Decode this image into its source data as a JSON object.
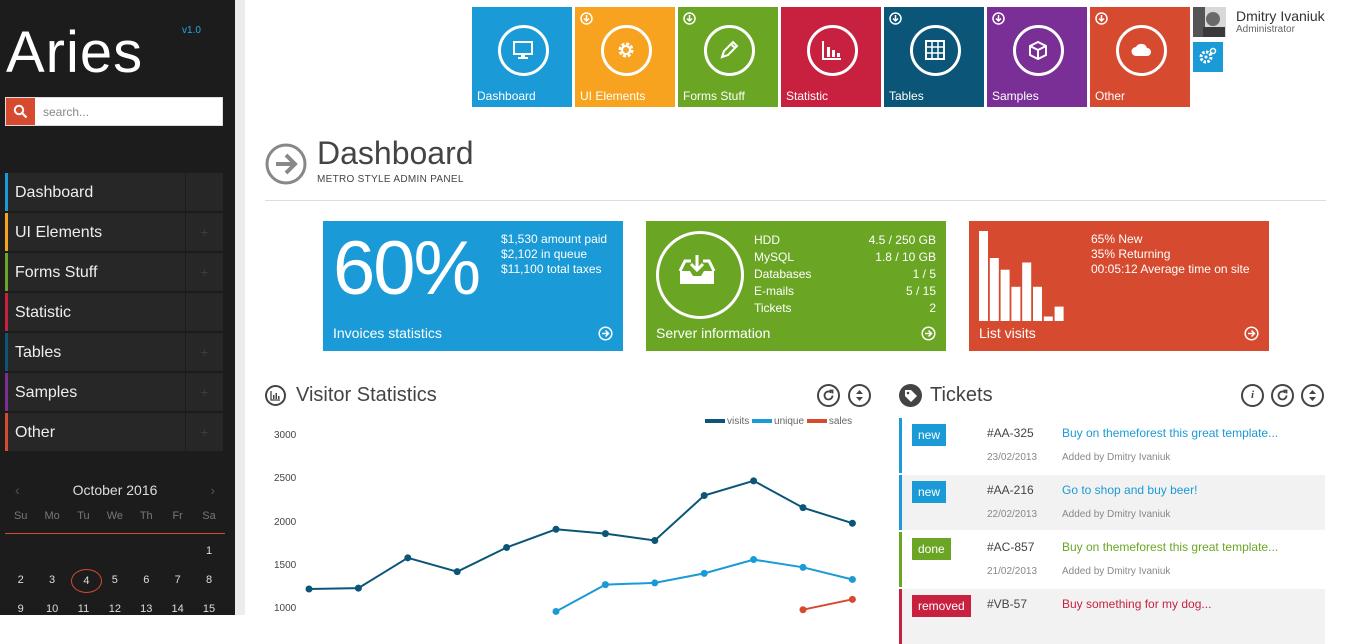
{
  "app": {
    "logo": "Aries",
    "version": "v1.0"
  },
  "search": {
    "placeholder": "search..."
  },
  "sidebar": {
    "items": [
      {
        "label": "Dashboard",
        "color": "#1a9ad6"
      },
      {
        "label": "UI Elements",
        "color": "#f8a31f"
      },
      {
        "label": "Forms Stuff",
        "color": "#6aa624"
      },
      {
        "label": "Statistic",
        "color": "#c8213f"
      },
      {
        "label": "Tables",
        "color": "#0a5578"
      },
      {
        "label": "Samples",
        "color": "#7a2f96"
      },
      {
        "label": "Other",
        "color": "#d64a2f"
      }
    ]
  },
  "calendar": {
    "month": "October 2016",
    "prev": "‹",
    "next": "›",
    "weekdays": [
      "Su",
      "Mo",
      "Tu",
      "We",
      "Th",
      "Fr",
      "Sa"
    ],
    "rows": [
      [
        "",
        "",
        "",
        "",
        "",
        "",
        "1"
      ],
      [
        "2",
        "3",
        "4",
        "5",
        "6",
        "7",
        "8"
      ],
      [
        "9",
        "10",
        "11",
        "12",
        "13",
        "14",
        "15"
      ]
    ],
    "today": "4"
  },
  "tiles": [
    {
      "label": "Dashboard",
      "color": "#1a9ad6",
      "icon": "monitor-icon",
      "arrow": false
    },
    {
      "label": "UI Elements",
      "color": "#f8a31f",
      "icon": "gear-icon",
      "arrow": true
    },
    {
      "label": "Forms Stuff",
      "color": "#6aa624",
      "icon": "pencil-icon",
      "arrow": true
    },
    {
      "label": "Statistic",
      "color": "#c8213f",
      "icon": "bar-chart-icon",
      "arrow": false
    },
    {
      "label": "Tables",
      "color": "#0a5578",
      "icon": "table-icon",
      "arrow": true
    },
    {
      "label": "Samples",
      "color": "#7a2f96",
      "icon": "box-icon",
      "arrow": true
    },
    {
      "label": "Other",
      "color": "#d64a2f",
      "icon": "cloud-icon",
      "arrow": true
    }
  ],
  "user": {
    "name": "Dmitry Ivaniuk",
    "role": "Administrator"
  },
  "page": {
    "title": "Dashboard",
    "subtitle": "METRO STYLE ADMIN PANEL"
  },
  "stats": {
    "invoices": {
      "percent": "60%",
      "lines": [
        "$1,530 amount paid",
        "$2,102 in queue",
        "$11,100 total taxes"
      ],
      "footer": "Invoices statistics",
      "color": "#1a9ad6"
    },
    "server": {
      "rows": [
        {
          "k": "HDD",
          "v": "4.5 / 250 GB"
        },
        {
          "k": "MySQL",
          "v": "1.8 / 10 GB"
        },
        {
          "k": "Databases",
          "v": "1 / 5"
        },
        {
          "k": "E-mails",
          "v": "5 / 15"
        },
        {
          "k": "Tickets",
          "v": "2"
        }
      ],
      "footer": "Server information",
      "color": "#6aa624"
    },
    "visits": {
      "lines": [
        "65% New",
        "35% Returning",
        "00:05:12 Average time on site"
      ],
      "footer": "List visits",
      "color": "#d64a2f",
      "bars": [
        1,
        0.7,
        0.57,
        0.38,
        0.65,
        0.38,
        0.05,
        0.16
      ]
    }
  },
  "visitor": {
    "title": "Visitor Statistics",
    "legend": [
      "visits",
      "unique",
      "sales"
    ],
    "yticks": [
      "3000",
      "2500",
      "2000",
      "1500",
      "1000"
    ]
  },
  "chart_data": {
    "type": "line",
    "title": "",
    "ylim": [
      1000,
      3000
    ],
    "yticks": [
      1000,
      1500,
      2000,
      2500,
      3000
    ],
    "series": [
      {
        "name": "visits",
        "color": "#0a5578",
        "values": [
          1220,
          1230,
          1580,
          1420,
          1700,
          1910,
          1860,
          1780,
          2300,
          2470,
          2160,
          1980
        ]
      },
      {
        "name": "unique",
        "color": "#1a9ad6",
        "values": [
          null,
          null,
          null,
          null,
          null,
          960,
          1270,
          1290,
          1400,
          1560,
          1470,
          1330
        ]
      },
      {
        "name": "sales",
        "color": "#d64a2f",
        "values": [
          null,
          null,
          null,
          null,
          null,
          null,
          null,
          null,
          null,
          null,
          980,
          1100
        ]
      }
    ]
  },
  "tickets": {
    "title": "Tickets",
    "items": [
      {
        "badge": "new",
        "badge_color": "#1a9ad6",
        "id": "#AA-325",
        "date": "23/02/2013",
        "text": "Buy on themeforest this great template...",
        "text_color": "#1a9ad6",
        "by": "Added by Dmitry Ivaniuk",
        "bg": "#ffffff"
      },
      {
        "badge": "new",
        "badge_color": "#1a9ad6",
        "id": "#AA-216",
        "date": "22/02/2013",
        "text": "Go to shop and buy beer!",
        "text_color": "#1a9ad6",
        "by": "Added by Dmitry Ivaniuk",
        "bg": "#f2f2f2"
      },
      {
        "badge": "done",
        "badge_color": "#6aa624",
        "id": "#AC-857",
        "date": "21/02/2013",
        "text": "Buy on themeforest this great template...",
        "text_color": "#6aa624",
        "by": "Added by Dmitry Ivaniuk",
        "bg": "#ffffff"
      },
      {
        "badge": "removed",
        "badge_color": "#c8213f",
        "id": "#VB-57",
        "date": "",
        "text": "Buy something for my dog...",
        "text_color": "#c8213f",
        "by": "",
        "bg": "#f2f2f2"
      }
    ]
  }
}
